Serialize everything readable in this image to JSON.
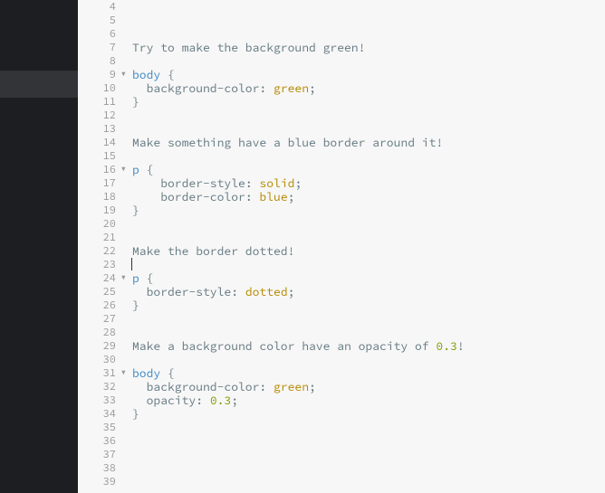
{
  "editor": {
    "startLine": 4,
    "cursorLine": 23,
    "lines": [
      {
        "n": 4,
        "tokens": []
      },
      {
        "n": 5,
        "tokens": []
      },
      {
        "n": 6,
        "tokens": []
      },
      {
        "n": 7,
        "tokens": [
          {
            "t": "Try to make the background green!",
            "c": "c-text"
          }
        ]
      },
      {
        "n": 8,
        "tokens": []
      },
      {
        "n": 9,
        "fold": true,
        "tokens": [
          {
            "t": "body",
            "c": "c-tag"
          },
          {
            "t": " ",
            "c": "c-punc"
          },
          {
            "t": "{",
            "c": "c-brace"
          }
        ]
      },
      {
        "n": 10,
        "tokens": [
          {
            "t": "  ",
            "c": "c-punc"
          },
          {
            "t": "background-color",
            "c": "c-prop"
          },
          {
            "t": ": ",
            "c": "c-punc"
          },
          {
            "t": "green",
            "c": "c-val"
          },
          {
            "t": ";",
            "c": "c-punc"
          }
        ]
      },
      {
        "n": 11,
        "tokens": [
          {
            "t": "}",
            "c": "c-brace"
          }
        ]
      },
      {
        "n": 12,
        "tokens": []
      },
      {
        "n": 13,
        "tokens": []
      },
      {
        "n": 14,
        "tokens": [
          {
            "t": "Make something have a blue border around it!",
            "c": "c-text"
          }
        ]
      },
      {
        "n": 15,
        "tokens": []
      },
      {
        "n": 16,
        "fold": true,
        "tokens": [
          {
            "t": "p",
            "c": "c-tag"
          },
          {
            "t": " ",
            "c": "c-punc"
          },
          {
            "t": "{",
            "c": "c-brace"
          }
        ]
      },
      {
        "n": 17,
        "tokens": [
          {
            "t": "    ",
            "c": "c-punc"
          },
          {
            "t": "border-style",
            "c": "c-prop"
          },
          {
            "t": ": ",
            "c": "c-punc"
          },
          {
            "t": "solid",
            "c": "c-val"
          },
          {
            "t": ";",
            "c": "c-punc"
          }
        ]
      },
      {
        "n": 18,
        "tokens": [
          {
            "t": "    ",
            "c": "c-punc"
          },
          {
            "t": "border-color",
            "c": "c-prop"
          },
          {
            "t": ": ",
            "c": "c-punc"
          },
          {
            "t": "blue",
            "c": "c-val"
          },
          {
            "t": ";",
            "c": "c-punc"
          }
        ]
      },
      {
        "n": 19,
        "tokens": [
          {
            "t": "}",
            "c": "c-brace"
          }
        ]
      },
      {
        "n": 20,
        "tokens": []
      },
      {
        "n": 21,
        "tokens": []
      },
      {
        "n": 22,
        "tokens": [
          {
            "t": "Make the border dotted!",
            "c": "c-text"
          }
        ]
      },
      {
        "n": 23,
        "cursor": true,
        "tokens": []
      },
      {
        "n": 24,
        "fold": true,
        "tokens": [
          {
            "t": "p",
            "c": "c-tag"
          },
          {
            "t": " ",
            "c": "c-punc"
          },
          {
            "t": "{",
            "c": "c-brace"
          }
        ]
      },
      {
        "n": 25,
        "tokens": [
          {
            "t": "  ",
            "c": "c-punc"
          },
          {
            "t": "border-style",
            "c": "c-prop"
          },
          {
            "t": ": ",
            "c": "c-punc"
          },
          {
            "t": "dotted",
            "c": "c-val"
          },
          {
            "t": ";",
            "c": "c-punc"
          }
        ]
      },
      {
        "n": 26,
        "tokens": [
          {
            "t": "}",
            "c": "c-brace"
          }
        ]
      },
      {
        "n": 27,
        "tokens": []
      },
      {
        "n": 28,
        "tokens": []
      },
      {
        "n": 29,
        "tokens": [
          {
            "t": "Make a background color have an opacity of ",
            "c": "c-text"
          },
          {
            "t": "0.3",
            "c": "c-num"
          },
          {
            "t": "!",
            "c": "c-text"
          }
        ]
      },
      {
        "n": 30,
        "tokens": []
      },
      {
        "n": 31,
        "fold": true,
        "tokens": [
          {
            "t": "body",
            "c": "c-tag"
          },
          {
            "t": " ",
            "c": "c-punc"
          },
          {
            "t": "{",
            "c": "c-brace"
          }
        ]
      },
      {
        "n": 32,
        "tokens": [
          {
            "t": "  ",
            "c": "c-punc"
          },
          {
            "t": "background-color",
            "c": "c-prop"
          },
          {
            "t": ": ",
            "c": "c-punc"
          },
          {
            "t": "green",
            "c": "c-val"
          },
          {
            "t": ";",
            "c": "c-punc"
          }
        ]
      },
      {
        "n": 33,
        "tokens": [
          {
            "t": "  ",
            "c": "c-punc"
          },
          {
            "t": "opacity",
            "c": "c-prop"
          },
          {
            "t": ": ",
            "c": "c-punc"
          },
          {
            "t": "0.3",
            "c": "c-num"
          },
          {
            "t": ";",
            "c": "c-punc"
          }
        ]
      },
      {
        "n": 34,
        "tokens": [
          {
            "t": "}",
            "c": "c-brace"
          }
        ]
      },
      {
        "n": 35,
        "tokens": []
      },
      {
        "n": 36,
        "tokens": []
      },
      {
        "n": 37,
        "tokens": []
      },
      {
        "n": 38,
        "tokens": []
      },
      {
        "n": 39,
        "tokens": []
      }
    ]
  }
}
